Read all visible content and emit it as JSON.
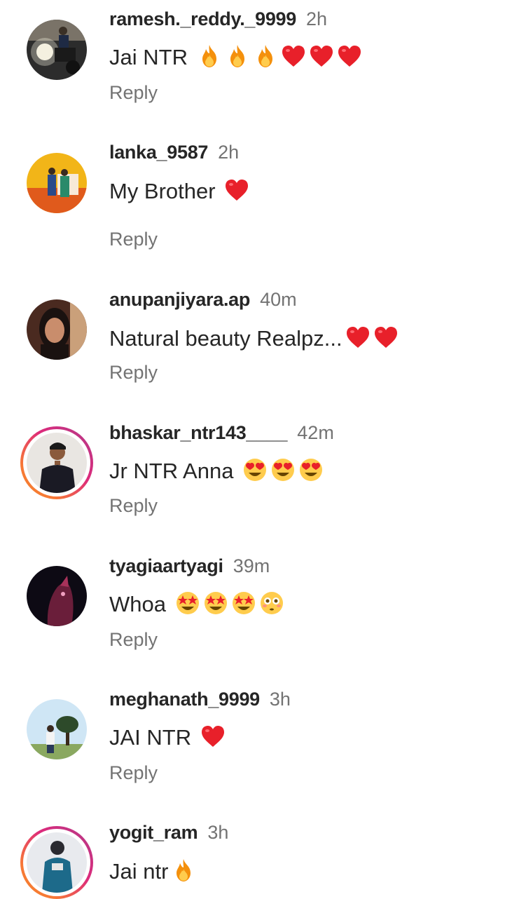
{
  "comments": [
    {
      "username": "ramesh._reddy._9999",
      "time": "2h",
      "text": "Jai NTR",
      "emojis": [
        "fire",
        "fire",
        "fire",
        "heart",
        "heart",
        "heart"
      ],
      "reply": "Reply",
      "story_ring": false
    },
    {
      "username": "lanka_9587",
      "time": "2h",
      "text": "My Brother",
      "emojis": [
        "heart"
      ],
      "reply": "Reply",
      "story_ring": false
    },
    {
      "username": "anupanjiyara.ap",
      "time": "40m",
      "text": "Natural beauty Realpz...",
      "emojis": [
        "heart",
        "heart"
      ],
      "reply": "Reply",
      "story_ring": false
    },
    {
      "username": "bhaskar_ntr143____",
      "time": "42m",
      "text": "Jr NTR Anna",
      "emojis": [
        "heart-eyes",
        "heart-eyes",
        "heart-eyes"
      ],
      "reply": "Reply",
      "story_ring": true
    },
    {
      "username": "tyagiaartyagi",
      "time": "39m",
      "text": "Whoa",
      "emojis": [
        "star-struck",
        "star-struck",
        "star-struck",
        "flushed"
      ],
      "reply": "Reply",
      "story_ring": false
    },
    {
      "username": "meghanath_9999",
      "time": "3h",
      "text": "JAI NTR",
      "emojis": [
        "heart"
      ],
      "reply": "Reply",
      "story_ring": false
    },
    {
      "username": "yogit_ram",
      "time": "3h",
      "text": "Jai ntr",
      "emojis": [
        "fire"
      ],
      "reply": "",
      "story_ring": true
    }
  ],
  "colors": {
    "text": "#262626",
    "secondary": "#737373",
    "heart": "#e8202a",
    "story_ring_start": "#f58529",
    "story_ring_end": "#8134af"
  }
}
